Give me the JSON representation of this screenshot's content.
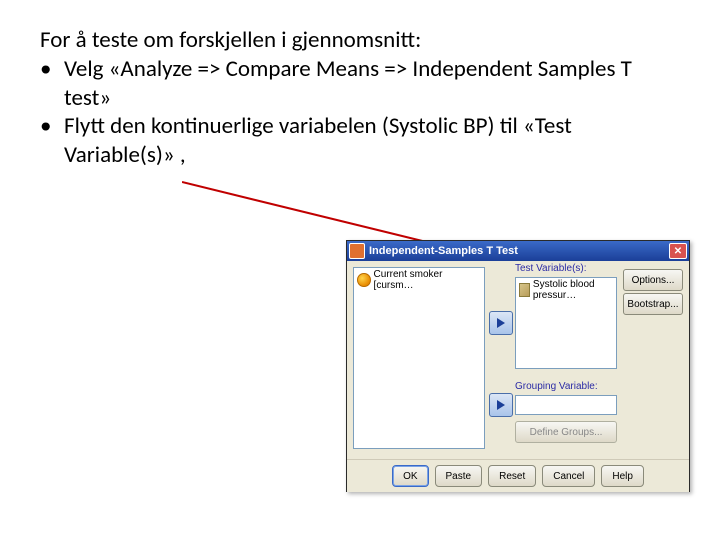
{
  "intro": "For å teste om forskjellen i gjennomsnitt:",
  "bullets": [
    "Velg «Analyze => Compare Means => Independent Samples T test»",
    "Flytt den kontinuerlige variabelen (Systolic BP) til «Test Variable(s)» ,"
  ],
  "dialog": {
    "title": "Independent-Samples T Test",
    "source_vars": [
      "Current smoker [cursm…"
    ],
    "test_label": "Test Variable(s):",
    "test_vars": [
      "Systolic blood pressur…"
    ],
    "grouping_label": "Grouping Variable:",
    "define_groups": "Define Groups...",
    "side": {
      "options": "Options...",
      "bootstrap": "Bootstrap..."
    },
    "buttons": {
      "ok": "OK",
      "paste": "Paste",
      "reset": "Reset",
      "cancel": "Cancel",
      "help": "Help"
    }
  }
}
